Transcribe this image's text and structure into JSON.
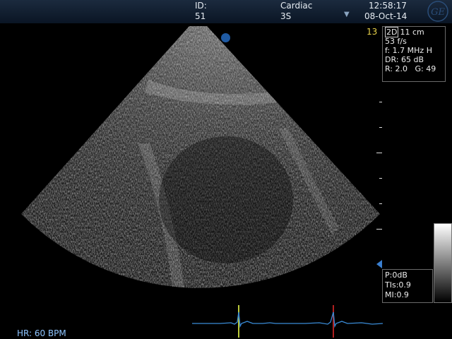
{
  "header": {
    "id_label": "ID:",
    "id_value": "51",
    "exam": "Cardiac",
    "probe": "3S",
    "time": "12:58:17",
    "date": "08-Oct-14",
    "logo": "GE"
  },
  "image": {
    "frame_number": "13",
    "params": {
      "mode": "2D",
      "depth": "11 cm",
      "frame_rate": "53 f/s",
      "frequency": "f: 1.7 MHz H",
      "dynamic_range": "DR: 65 dB",
      "rotation": "R: 2.0",
      "gain": "G: 49"
    },
    "safety": {
      "power": "P:0dB",
      "tis": "TIs:0.9",
      "mi": "MI:0.9"
    }
  },
  "ecg": {
    "heart_rate": "HR: 60 BPM",
    "trace_color": "#3a8bd6",
    "marker_colors": [
      "#b9c93a",
      "#b02020"
    ]
  },
  "colors": {
    "header_bg": "#10203a",
    "probe_marker": "#1f5aa3",
    "frame_number": "#e8d24a"
  }
}
